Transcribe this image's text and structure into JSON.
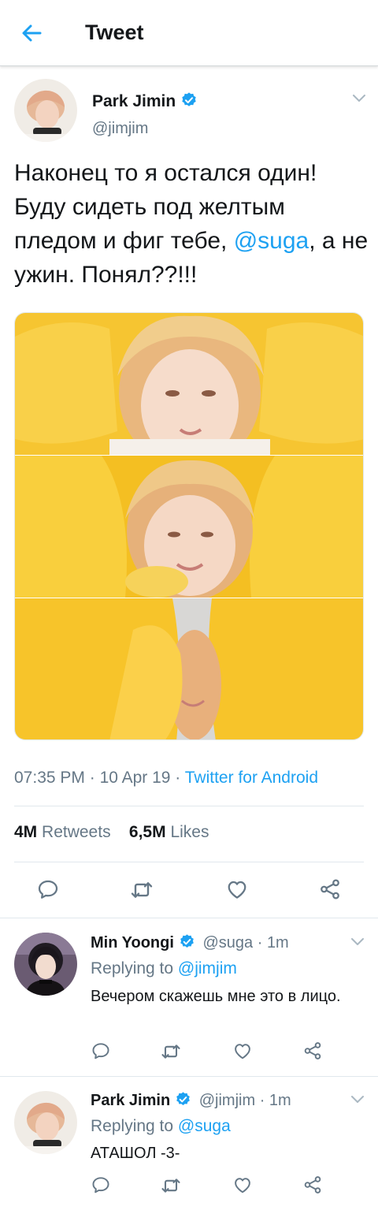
{
  "header": {
    "title": "Tweet"
  },
  "tweet": {
    "author_name": "Park Jimin",
    "handle": "@jimjim",
    "text_before": "Наконец то я остался один! Буду сидеть под желтым пледом и фиг тебе, ",
    "mention": "@suga",
    "text_after": ", а не ужин. Понял??!!!",
    "time": "07:35 PM",
    "date": "10 Apr 19",
    "source": "Twitter for Android",
    "retweets_count": "4M",
    "retweets_label": "Retweets",
    "likes_count": "6,5M",
    "likes_label": "Likes"
  },
  "replies": [
    {
      "author_name": "Min Yoongi",
      "handle": "@suga",
      "age": "1m",
      "replying_label": "Replying to",
      "replying_to": "@jimjim",
      "text": "Вечером скажешь мне это в лицо."
    },
    {
      "author_name": "Park Jimin",
      "handle": "@jimjim",
      "age": "1m",
      "replying_label": "Replying to",
      "replying_to": "@suga",
      "text": "АТАШОЛ -3-"
    }
  ],
  "colors": {
    "accent": "#1da1f2",
    "secondary_text": "#657786",
    "primary_text": "#14171a",
    "divider": "#e1e8ed"
  },
  "icons": [
    "back-arrow-icon",
    "verified-badge-icon",
    "chevron-down-icon",
    "reply-icon",
    "retweet-icon",
    "like-icon",
    "share-icon"
  ]
}
